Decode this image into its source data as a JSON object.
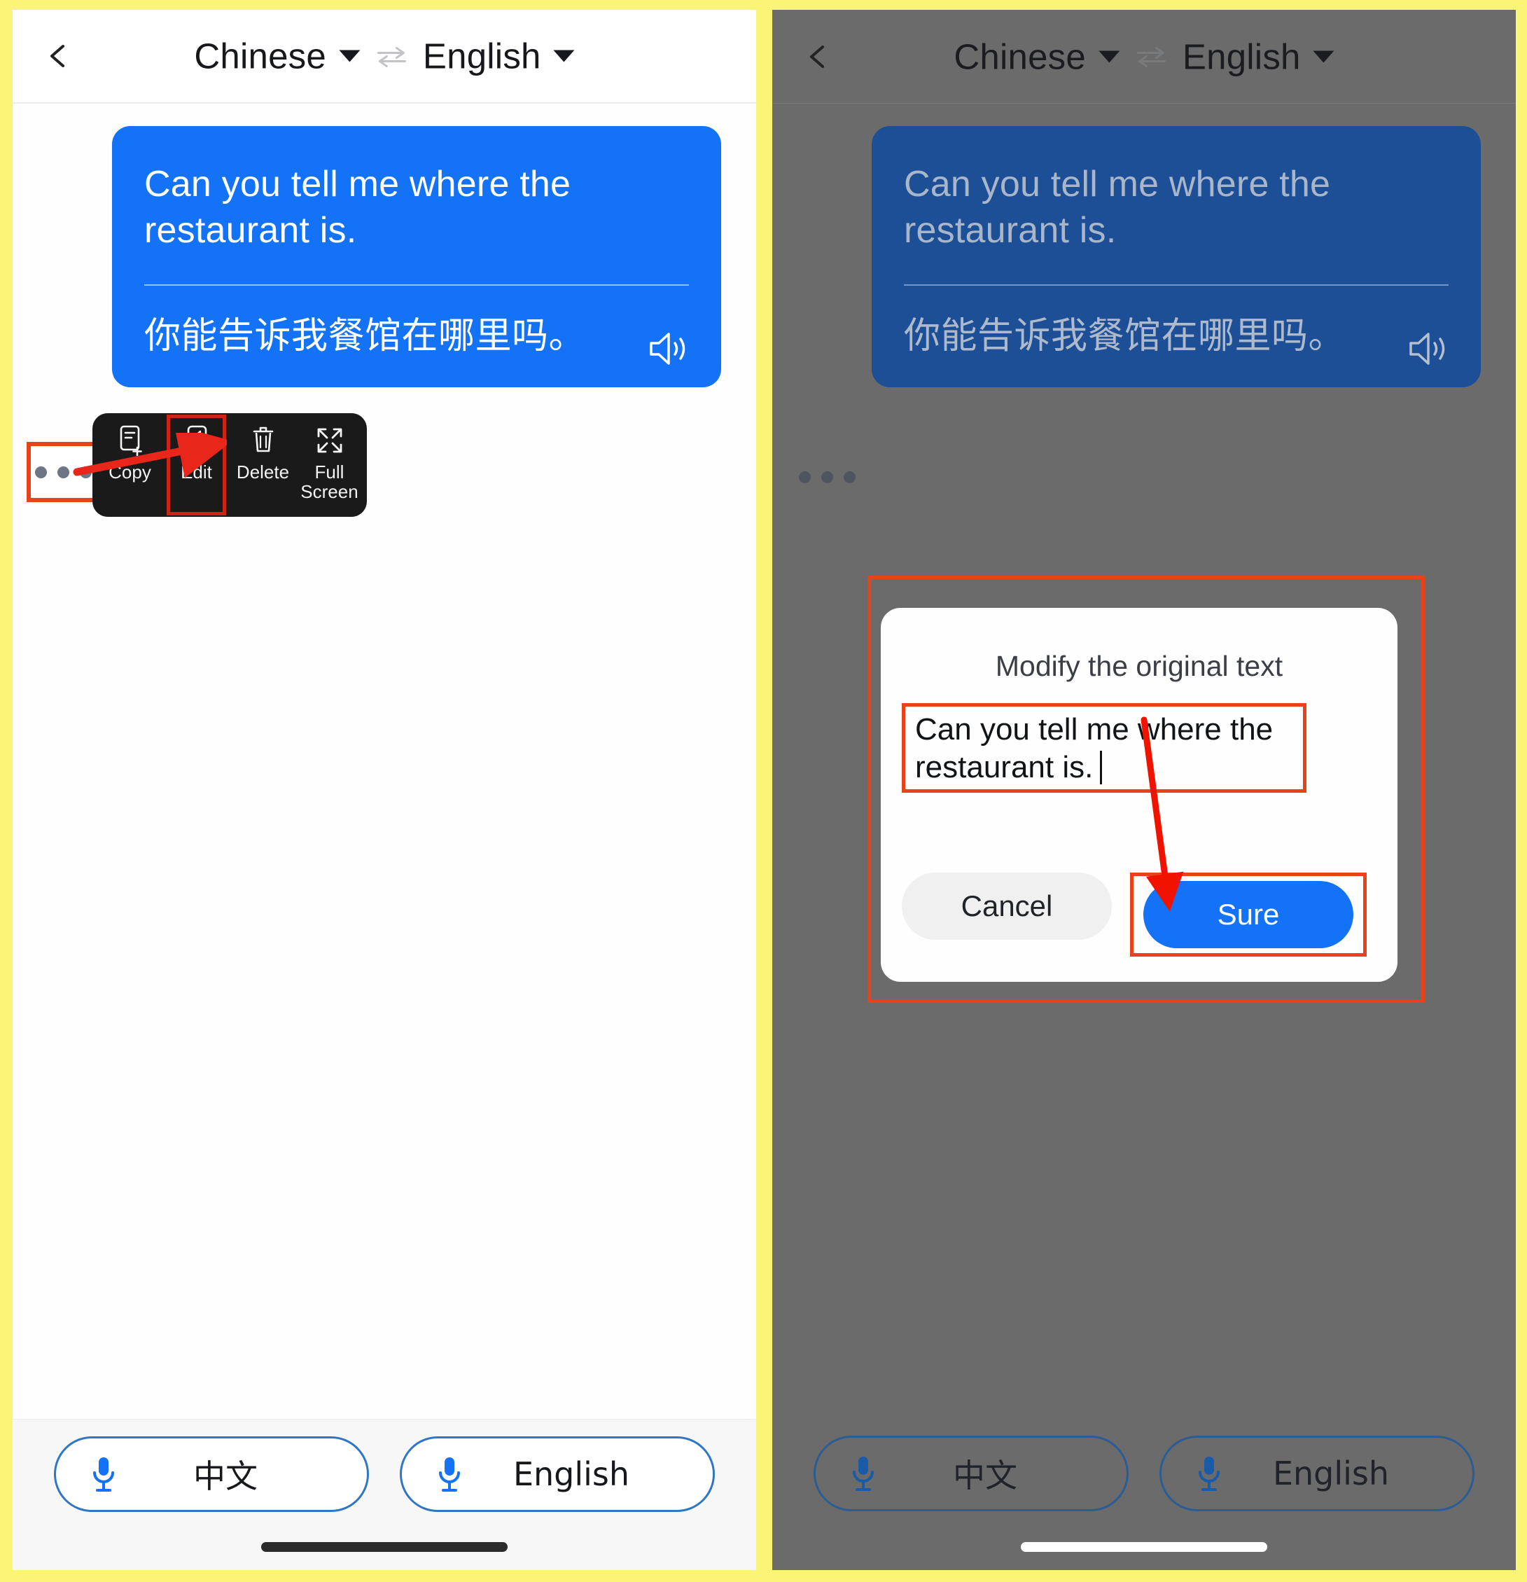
{
  "app": {
    "accent_blue": "#1372f5",
    "highlight_red": "#e8421a",
    "frame_yellow": "#fbf577",
    "bubble_blue_dimmed": "#1d4f96"
  },
  "header": {
    "back_icon": "chevron-left-icon",
    "source_language": "Chinese",
    "target_language": "English",
    "swap_icon": "swap-arrows-icon",
    "caret_icon": "chevron-down-icon"
  },
  "conversation": {
    "bubble": {
      "source_text": "Can you tell me where the restaurant is.",
      "translated_text": "你能告诉我餐馆在哪里吗。",
      "speaker_icon": "speaker-icon",
      "more_icon": "more-horizontal-icon"
    }
  },
  "context_menu": {
    "items": [
      {
        "label": "Copy",
        "icon": "copy-document-icon",
        "highlighted": false
      },
      {
        "label": "Edit",
        "icon": "edit-pen-icon",
        "highlighted": true
      },
      {
        "label": "Delete",
        "icon": "trash-icon",
        "highlighted": false
      },
      {
        "label": "Full\nScreen",
        "icon": "fullscreen-expand-icon",
        "highlighted": false
      }
    ]
  },
  "dialog": {
    "title": "Modify the original text",
    "input_value": "Can you tell me where the restaurant is.",
    "cancel_label": "Cancel",
    "confirm_label": "Sure"
  },
  "mic_bar": {
    "buttons": [
      {
        "label": "中文",
        "icon": "microphone-icon"
      },
      {
        "label": "English",
        "icon": "microphone-icon"
      }
    ]
  },
  "annotations": {
    "arrow_left": "red-arrow-pointing-to-edit",
    "arrow_right": "red-arrow-pointing-to-sure"
  }
}
